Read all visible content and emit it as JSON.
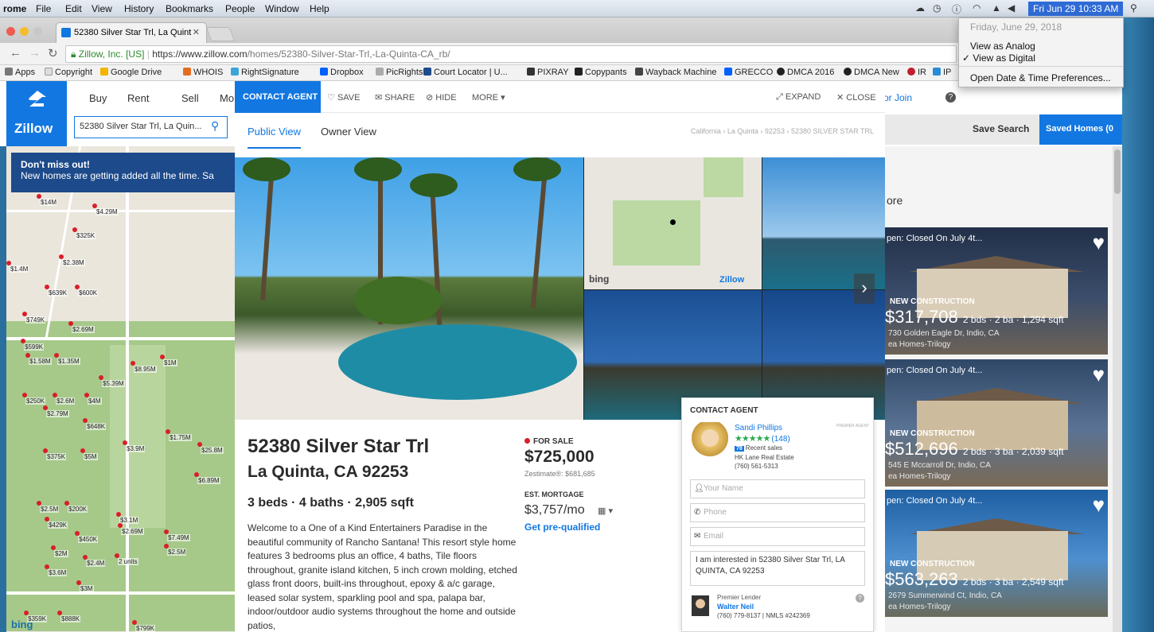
{
  "menubar": {
    "app": "rome",
    "items": [
      "File",
      "Edit",
      "View",
      "History",
      "Bookmarks",
      "People",
      "Window",
      "Help"
    ],
    "clock": "Fri Jun 29  10:33 AM"
  },
  "clock_menu": {
    "date": "Friday, June 29, 2018",
    "options": [
      "View as Analog",
      "✓ View as Digital",
      "Open Date & Time Preferences..."
    ]
  },
  "browser": {
    "tab_title": "52380 Silver Star Trl, La Quint",
    "url_site": "Zillow, Inc. [US]",
    "url_host": "https://www.zillow.com",
    "url_path": "/homes/52380-Silver-Star-Trl,-La-Quinta-CA_rb/",
    "bookmarks": [
      "Apps",
      "Copyright",
      "Google Drive",
      "WHOIS",
      "RightSignature",
      "Dropbox",
      "PicRights",
      "Court Locator | U...",
      "PIXRAY",
      "Copypants",
      "Wayback Machine",
      "GRECCO",
      "DMCA 2016",
      "DMCA New",
      "IR",
      "IP"
    ]
  },
  "zillow": {
    "logo": "Zillow",
    "nav": [
      "Buy",
      "Rent",
      "Sell",
      "Mo"
    ],
    "search_value": "52380 Silver Star Trl, La Quin...",
    "signin": "or Join",
    "save_search": "Save Search",
    "saved_homes": "Saved Homes (0",
    "banner_title": "Don't miss out!",
    "banner_text": "New homes are getting added all the time. Sa",
    "more": "ore",
    "map_labels": [
      "$14M",
      "$4.29M",
      "$325K",
      "$2.38M",
      "$1.4M",
      "$639K",
      "$600K",
      "$749K",
      "$2.69M",
      "$599K",
      "$1.58M",
      "$1.35M",
      "$8.95M",
      "$1M",
      "$5.39M",
      "$250K",
      "$2.6M",
      "$4M",
      "$2.79M",
      "$648K",
      "$1.75M",
      "$3.9M",
      "$25.8M",
      "$375K",
      "$5M",
      "$6.89M",
      "$2.5M",
      "$200K",
      "$429K",
      "$3.1M",
      "$450K",
      "$2.69M",
      "$7.49M",
      "$2M",
      "$2.4M",
      "2 units",
      "$2.5M",
      "$3.6M",
      "$3M",
      "$359K",
      "$888K",
      "$799K"
    ],
    "listings": [
      {
        "status": "pen: Closed On July 4t...",
        "tag": "NEW CONSTRUCTION",
        "price": "$317,708",
        "facts": "2 bds · 2 ba · 1,294 sqft",
        "address": "730 Golden Eagle Dr, Indio, CA",
        "builder": "ea Homes-Trilogy"
      },
      {
        "status": "pen: Closed On July 4t...",
        "tag": "NEW CONSTRUCTION",
        "price": "$512,696",
        "facts": "2 bds · 3 ba · 2,039 sqft",
        "address": "545 E Mccarroll Dr, Indio, CA",
        "builder": "ea Homes-Trilogy"
      },
      {
        "status": "pen: Closed On July 4t...",
        "tag": "NEW CONSTRUCTION",
        "price": "$563,263",
        "facts": "2 bds · 3 ba · 2,549 sqft",
        "address": "2679 Summerwind Ct, Indio, CA",
        "builder": "ea Homes-Trilogy"
      }
    ]
  },
  "modal": {
    "contact_agent": "CONTACT AGENT",
    "save": "SAVE",
    "share": "SHARE",
    "hide": "HIDE",
    "more": "MORE",
    "expand": "EXPAND",
    "close": "CLOSE",
    "tab_public": "Public View",
    "tab_owner": "Owner View",
    "breadcrumb": "California › La Quinta › 92253 › 52380 SILVER STAR TRL",
    "map_bing": "bing",
    "map_zillow": "Zillow",
    "street1": "Silver Star Trl",
    "city_state": "La Quinta, CA 92253",
    "facts": "3 beds · 4 baths · 2,905 sqft",
    "status": "FOR SALE",
    "price": "$725,000",
    "zestimate": "Zestimate®: $681,685",
    "est_mortgage_label": "EST. MORTGAGE",
    "est_mortgage": "$3,757/mo",
    "prequal": "Get pre-qualified",
    "description": "Welcome to a One of a Kind Entertainers Paradise in the beautiful community of Rancho Santana! This resort style home features 3 bedrooms plus an office, 4 baths, Tile floors throughout, granite island kitchen, 5 inch crown molding, etched glass front doors, built-ins throughout, epoxy & a/c garage, leased solar system, sparkling pool and spa, palapa bar, indoor/outdoor audio systems throughout the home and outside patios,"
  },
  "agent_form": {
    "header": "CONTACT AGENT",
    "badge": "PREMIER AGENT",
    "name": "Sandi Phillips",
    "stars": "★★★★★",
    "reviews": "(148)",
    "recent_count": "78",
    "recent_label": "Recent sales",
    "brokerage": "HK Lane Real Estate",
    "phone": "(760) 561-5313",
    "name_placeholder": "Your Name",
    "phone_placeholder": "Phone",
    "email_placeholder": "Email",
    "message": "I am interested in 52380 Silver Star Trl, LA QUINTA, CA 92253",
    "lender_label": "Premier Lender",
    "lender_name": "Walter Neil",
    "lender_phone": "(760) 779-8137 | NMLS #242369"
  },
  "map_footer": "bing"
}
